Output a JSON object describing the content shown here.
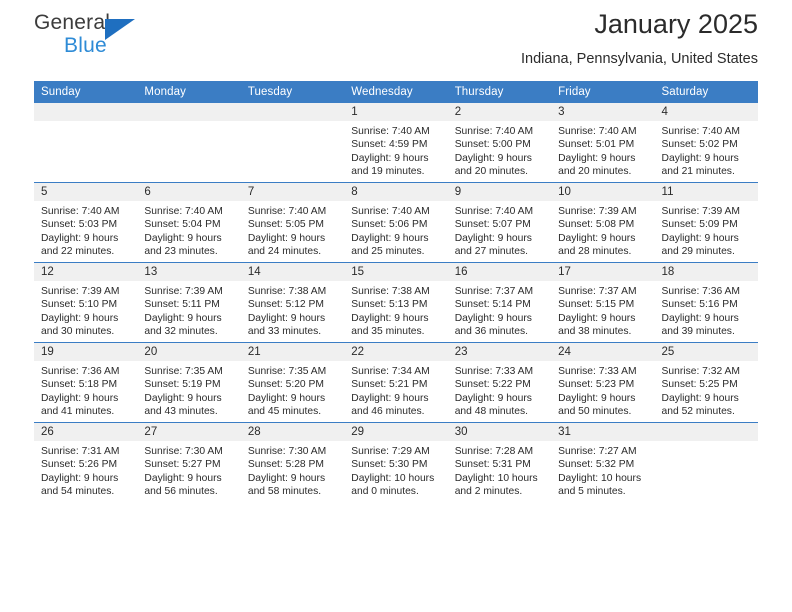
{
  "brand": {
    "name_top": "General",
    "name_bottom": "Blue",
    "triangle_color": "#1f6fc0",
    "blue_text_color": "#2e8bd6"
  },
  "header": {
    "title": "January 2025",
    "subtitle": "Indiana, Pennsylvania, United States"
  },
  "theme": {
    "header_row_bg": "#3b7dc4",
    "daynum_band_bg": "#f0f0f0",
    "row_divider": "#3b7dc4"
  },
  "weekday_headers": [
    "Sunday",
    "Monday",
    "Tuesday",
    "Wednesday",
    "Thursday",
    "Friday",
    "Saturday"
  ],
  "labels": {
    "sunrise_prefix": "Sunrise: ",
    "sunset_prefix": "Sunset: ",
    "daylight_prefix": "Daylight: "
  },
  "weeks": [
    [
      {
        "day": "",
        "empty": true
      },
      {
        "day": "",
        "empty": true
      },
      {
        "day": "",
        "empty": true
      },
      {
        "day": "1",
        "sunrise": "Sunrise: 7:40 AM",
        "sunset": "Sunset: 4:59 PM",
        "daylight1": "Daylight: 9 hours",
        "daylight2": "and 19 minutes."
      },
      {
        "day": "2",
        "sunrise": "Sunrise: 7:40 AM",
        "sunset": "Sunset: 5:00 PM",
        "daylight1": "Daylight: 9 hours",
        "daylight2": "and 20 minutes."
      },
      {
        "day": "3",
        "sunrise": "Sunrise: 7:40 AM",
        "sunset": "Sunset: 5:01 PM",
        "daylight1": "Daylight: 9 hours",
        "daylight2": "and 20 minutes."
      },
      {
        "day": "4",
        "sunrise": "Sunrise: 7:40 AM",
        "sunset": "Sunset: 5:02 PM",
        "daylight1": "Daylight: 9 hours",
        "daylight2": "and 21 minutes."
      }
    ],
    [
      {
        "day": "5",
        "sunrise": "Sunrise: 7:40 AM",
        "sunset": "Sunset: 5:03 PM",
        "daylight1": "Daylight: 9 hours",
        "daylight2": "and 22 minutes."
      },
      {
        "day": "6",
        "sunrise": "Sunrise: 7:40 AM",
        "sunset": "Sunset: 5:04 PM",
        "daylight1": "Daylight: 9 hours",
        "daylight2": "and 23 minutes."
      },
      {
        "day": "7",
        "sunrise": "Sunrise: 7:40 AM",
        "sunset": "Sunset: 5:05 PM",
        "daylight1": "Daylight: 9 hours",
        "daylight2": "and 24 minutes."
      },
      {
        "day": "8",
        "sunrise": "Sunrise: 7:40 AM",
        "sunset": "Sunset: 5:06 PM",
        "daylight1": "Daylight: 9 hours",
        "daylight2": "and 25 minutes."
      },
      {
        "day": "9",
        "sunrise": "Sunrise: 7:40 AM",
        "sunset": "Sunset: 5:07 PM",
        "daylight1": "Daylight: 9 hours",
        "daylight2": "and 27 minutes."
      },
      {
        "day": "10",
        "sunrise": "Sunrise: 7:39 AM",
        "sunset": "Sunset: 5:08 PM",
        "daylight1": "Daylight: 9 hours",
        "daylight2": "and 28 minutes."
      },
      {
        "day": "11",
        "sunrise": "Sunrise: 7:39 AM",
        "sunset": "Sunset: 5:09 PM",
        "daylight1": "Daylight: 9 hours",
        "daylight2": "and 29 minutes."
      }
    ],
    [
      {
        "day": "12",
        "sunrise": "Sunrise: 7:39 AM",
        "sunset": "Sunset: 5:10 PM",
        "daylight1": "Daylight: 9 hours",
        "daylight2": "and 30 minutes."
      },
      {
        "day": "13",
        "sunrise": "Sunrise: 7:39 AM",
        "sunset": "Sunset: 5:11 PM",
        "daylight1": "Daylight: 9 hours",
        "daylight2": "and 32 minutes."
      },
      {
        "day": "14",
        "sunrise": "Sunrise: 7:38 AM",
        "sunset": "Sunset: 5:12 PM",
        "daylight1": "Daylight: 9 hours",
        "daylight2": "and 33 minutes."
      },
      {
        "day": "15",
        "sunrise": "Sunrise: 7:38 AM",
        "sunset": "Sunset: 5:13 PM",
        "daylight1": "Daylight: 9 hours",
        "daylight2": "and 35 minutes."
      },
      {
        "day": "16",
        "sunrise": "Sunrise: 7:37 AM",
        "sunset": "Sunset: 5:14 PM",
        "daylight1": "Daylight: 9 hours",
        "daylight2": "and 36 minutes."
      },
      {
        "day": "17",
        "sunrise": "Sunrise: 7:37 AM",
        "sunset": "Sunset: 5:15 PM",
        "daylight1": "Daylight: 9 hours",
        "daylight2": "and 38 minutes."
      },
      {
        "day": "18",
        "sunrise": "Sunrise: 7:36 AM",
        "sunset": "Sunset: 5:16 PM",
        "daylight1": "Daylight: 9 hours",
        "daylight2": "and 39 minutes."
      }
    ],
    [
      {
        "day": "19",
        "sunrise": "Sunrise: 7:36 AM",
        "sunset": "Sunset: 5:18 PM",
        "daylight1": "Daylight: 9 hours",
        "daylight2": "and 41 minutes."
      },
      {
        "day": "20",
        "sunrise": "Sunrise: 7:35 AM",
        "sunset": "Sunset: 5:19 PM",
        "daylight1": "Daylight: 9 hours",
        "daylight2": "and 43 minutes."
      },
      {
        "day": "21",
        "sunrise": "Sunrise: 7:35 AM",
        "sunset": "Sunset: 5:20 PM",
        "daylight1": "Daylight: 9 hours",
        "daylight2": "and 45 minutes."
      },
      {
        "day": "22",
        "sunrise": "Sunrise: 7:34 AM",
        "sunset": "Sunset: 5:21 PM",
        "daylight1": "Daylight: 9 hours",
        "daylight2": "and 46 minutes."
      },
      {
        "day": "23",
        "sunrise": "Sunrise: 7:33 AM",
        "sunset": "Sunset: 5:22 PM",
        "daylight1": "Daylight: 9 hours",
        "daylight2": "and 48 minutes."
      },
      {
        "day": "24",
        "sunrise": "Sunrise: 7:33 AM",
        "sunset": "Sunset: 5:23 PM",
        "daylight1": "Daylight: 9 hours",
        "daylight2": "and 50 minutes."
      },
      {
        "day": "25",
        "sunrise": "Sunrise: 7:32 AM",
        "sunset": "Sunset: 5:25 PM",
        "daylight1": "Daylight: 9 hours",
        "daylight2": "and 52 minutes."
      }
    ],
    [
      {
        "day": "26",
        "sunrise": "Sunrise: 7:31 AM",
        "sunset": "Sunset: 5:26 PM",
        "daylight1": "Daylight: 9 hours",
        "daylight2": "and 54 minutes."
      },
      {
        "day": "27",
        "sunrise": "Sunrise: 7:30 AM",
        "sunset": "Sunset: 5:27 PM",
        "daylight1": "Daylight: 9 hours",
        "daylight2": "and 56 minutes."
      },
      {
        "day": "28",
        "sunrise": "Sunrise: 7:30 AM",
        "sunset": "Sunset: 5:28 PM",
        "daylight1": "Daylight: 9 hours",
        "daylight2": "and 58 minutes."
      },
      {
        "day": "29",
        "sunrise": "Sunrise: 7:29 AM",
        "sunset": "Sunset: 5:30 PM",
        "daylight1": "Daylight: 10 hours",
        "daylight2": "and 0 minutes."
      },
      {
        "day": "30",
        "sunrise": "Sunrise: 7:28 AM",
        "sunset": "Sunset: 5:31 PM",
        "daylight1": "Daylight: 10 hours",
        "daylight2": "and 2 minutes."
      },
      {
        "day": "31",
        "sunrise": "Sunrise: 7:27 AM",
        "sunset": "Sunset: 5:32 PM",
        "daylight1": "Daylight: 10 hours",
        "daylight2": "and 5 minutes."
      },
      {
        "day": "",
        "empty": true
      }
    ]
  ]
}
